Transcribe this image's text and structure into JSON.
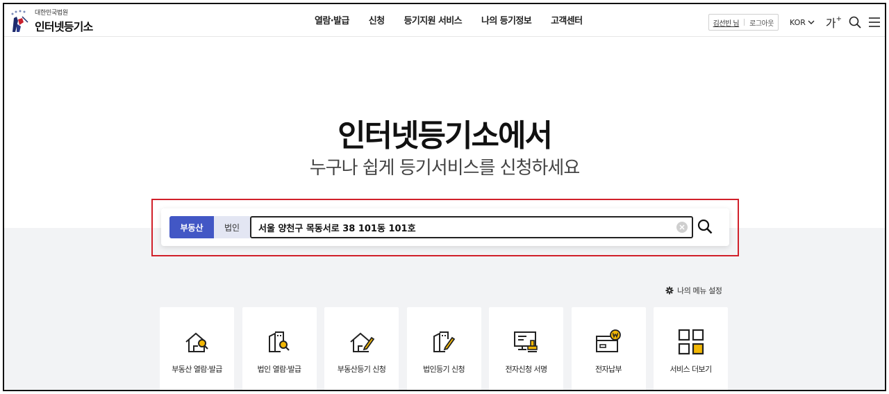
{
  "header": {
    "logo_sub": "대한민국법원",
    "logo_main": "인터넷등기소",
    "nav": [
      "열람·발급",
      "신청",
      "등기지원 서비스",
      "나의 등기정보",
      "고객센터"
    ],
    "user_name": "김선빈 님",
    "logout_label": "로그아웃",
    "language": "KOR",
    "font_size_label": "가",
    "font_size_plus": "+"
  },
  "hero": {
    "title": "인터넷등기소에서",
    "subtitle": "누구나 쉽게 등기서비스를 신청하세요"
  },
  "search": {
    "tab_real_estate": "부동산",
    "tab_corporation": "법인",
    "active_tab": "부동산",
    "value": "서울 양천구 목동서로 38 101동 101호",
    "accent_color": "#4257c5",
    "highlight_color": "#d1202a"
  },
  "menu_setting_label": "나의 메뉴 설정",
  "quick_menu": [
    {
      "label": "부동산 열람·발급",
      "icon": "house-search-icon"
    },
    {
      "label": "법인 열람·발급",
      "icon": "building-search-icon"
    },
    {
      "label": "부동산등기 신청",
      "icon": "house-pen-icon"
    },
    {
      "label": "법인등기 신청",
      "icon": "building-pen-icon"
    },
    {
      "label": "전자신청 서명",
      "icon": "monitor-stamp-icon"
    },
    {
      "label": "전자납부",
      "icon": "card-won-icon"
    },
    {
      "label": "서비스 더보기",
      "icon": "grid-more-icon"
    }
  ]
}
